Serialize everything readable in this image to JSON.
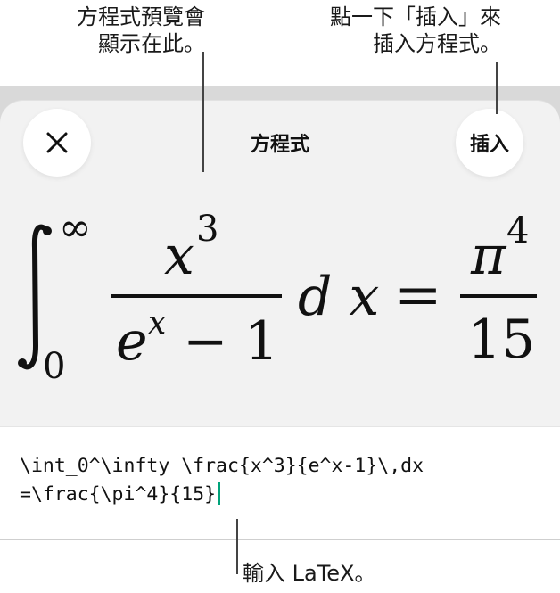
{
  "callouts": {
    "preview": "方程式預覽會\n顯示在此。",
    "insert": "點一下「插入」來\n插入方程式。",
    "latex": "輸入 LaTeX。"
  },
  "sheet": {
    "title": "方程式",
    "insert_label": "插入",
    "close_icon": "close-icon"
  },
  "equation": {
    "integral_lower": "0",
    "integral_upper": "∞",
    "numerator_base": "x",
    "numerator_exp": "3",
    "denominator_base": "e",
    "denominator_exp": "x",
    "denominator_rest": " − 1",
    "differential": "d x",
    "equals": "=",
    "rhs_numerator_base": "π",
    "rhs_numerator_exp": "4",
    "rhs_denominator": "15"
  },
  "input": {
    "latex": "\\int_0^\\infty \\frac{x^3}{e^x-1}\\,dx\n=\\frac{\\pi^4}{15}"
  },
  "colors": {
    "cursor": "#00a37a",
    "sheet_background": "#f2f2f2"
  }
}
